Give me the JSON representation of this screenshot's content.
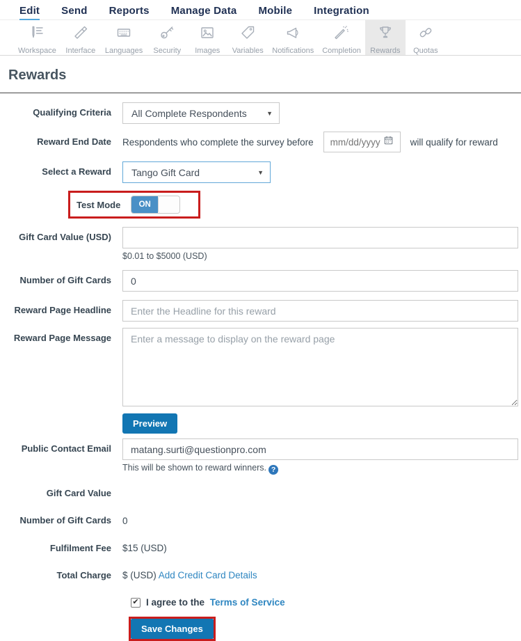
{
  "nav": {
    "items": [
      {
        "label": "Edit"
      },
      {
        "label": "Send"
      },
      {
        "label": "Reports"
      },
      {
        "label": "Manage Data"
      },
      {
        "label": "Mobile"
      },
      {
        "label": "Integration"
      }
    ]
  },
  "toolbar": {
    "items": [
      {
        "label": "Workspace"
      },
      {
        "label": "Interface"
      },
      {
        "label": "Languages"
      },
      {
        "label": "Security"
      },
      {
        "label": "Images"
      },
      {
        "label": "Variables"
      },
      {
        "label": "Notifications"
      },
      {
        "label": "Completion"
      },
      {
        "label": "Rewards"
      },
      {
        "label": "Quotas"
      }
    ]
  },
  "page": {
    "title": "Rewards"
  },
  "form": {
    "qualifying_criteria": {
      "label": "Qualifying Criteria",
      "value": "All Complete Respondents"
    },
    "reward_end_date": {
      "label": "Reward End Date",
      "prefix": "Respondents who complete the survey before",
      "placeholder": "mm/dd/yyyy",
      "suffix": "will qualify for reward"
    },
    "select_reward": {
      "label": "Select a Reward",
      "value": "Tango Gift Card"
    },
    "test_mode": {
      "label": "Test Mode",
      "state": "ON"
    },
    "gift_card_value": {
      "label": "Gift Card Value (USD)",
      "value": "",
      "helper": "$0.01 to $5000 (USD)"
    },
    "number_of_gift_cards": {
      "label": "Number of Gift Cards",
      "value": "0"
    },
    "reward_page_headline": {
      "label": "Reward Page Headline",
      "placeholder": "Enter the Headline for this reward"
    },
    "reward_page_message": {
      "label": "Reward Page Message",
      "placeholder": "Enter a message to display on the reward page"
    },
    "preview_button": "Preview",
    "public_contact_email": {
      "label": "Public Contact Email",
      "value": "matang.surti@questionpro.com",
      "helper": "This will be shown to reward winners.",
      "help_badge": "?"
    },
    "summary": {
      "gift_card_value": {
        "label": "Gift Card Value",
        "value": ""
      },
      "number_of_gift_cards": {
        "label": "Number of Gift Cards",
        "value": "0"
      },
      "fulfilment_fee": {
        "label": "Fulfilment Fee",
        "value": "$15 (USD)"
      },
      "total_charge": {
        "label": "Total Charge",
        "value": "$ (USD)",
        "link": "Add Credit Card Details"
      }
    },
    "agree": {
      "checkmark": "✔",
      "text": "I agree to the",
      "link": "Terms of Service"
    },
    "save_button": "Save Changes"
  },
  "colors": {
    "accent_blue": "#1276b3",
    "link_blue": "#2e86c1",
    "toggle_blue": "#4a90c6",
    "annotation_red": "#c91d1d",
    "nav_navy": "#1f3053",
    "active_tab_bg": "#e9e9e9"
  }
}
